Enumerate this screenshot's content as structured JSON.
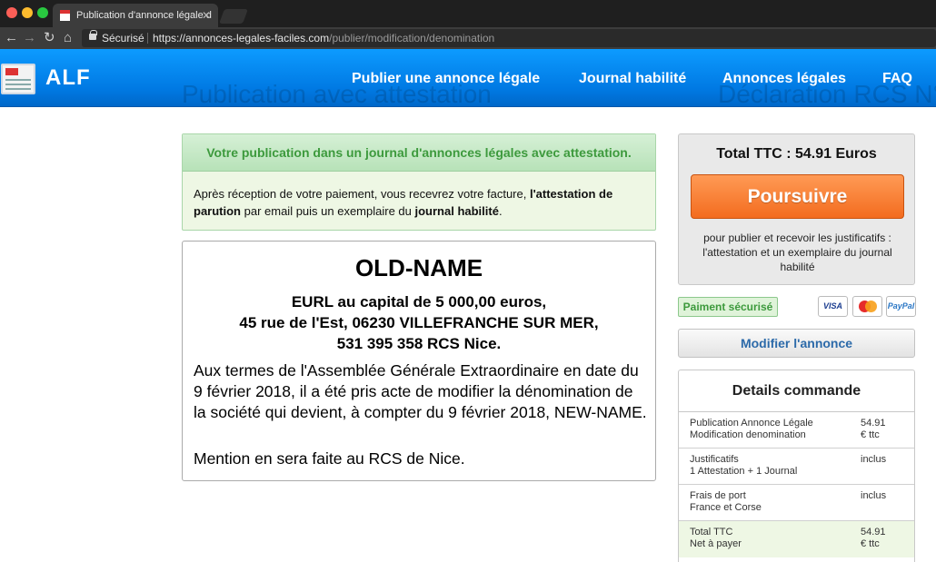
{
  "browser": {
    "tab_title": "Publication d'annonce légale d",
    "tab_close": "✕",
    "secure_label": "Sécurisé",
    "url_host": "https://annonces-legales-faciles.com",
    "url_path": "/publier/modification/denomination"
  },
  "header": {
    "logo": "ALF",
    "ghost_title": "Publication avec attestation",
    "ghost_right": "Déclaration RCS N°",
    "nav": [
      {
        "label": "Publier une annonce légale"
      },
      {
        "label": "Journal habilité"
      },
      {
        "label": "Annonces légales"
      },
      {
        "label": "FAQ"
      }
    ]
  },
  "notice": {
    "title": "Votre publication dans un journal d'annonces légales avec attestation.",
    "body_1": "Après réception de votre paiement, vous recevrez votre facture, ",
    "body_bold_1": "l'attestation de parution",
    "body_2": " par email puis un exemplaire du ",
    "body_bold_2": "journal habilité",
    "body_3": "."
  },
  "announcement": {
    "company": "OLD-NAME",
    "line1": "EURL au capital de 5 000,00 euros,",
    "line2": "45 rue de l'Est, 06230 VILLEFRANCHE SUR MER,",
    "line3": "531 395 358 RCS Nice.",
    "paragraph": "Aux termes de l'Assemblée Générale Extraordinaire en date du 9 février 2018, il a été pris acte de modifier la dénomination de la société qui devient, à compter du 9 février 2018, NEW-NAME.",
    "mention": "Mention en sera faite au RCS de Nice."
  },
  "sidebar": {
    "total": "Total TTC : 54.91 Euros",
    "pay_button": "Poursuivre",
    "pay_note": "pour publier et recevoir les justificatifs : l'attestation et un exemplaire du journal habilité",
    "secure_payment": "Paiment sécurisé",
    "cards": {
      "visa": "VISA",
      "paypal": "PayPal"
    },
    "modify_button": "Modifier l'annonce",
    "details_title": "Details commande",
    "details": [
      {
        "label_1": "Publication Annonce Légale",
        "label_2": "Modification denomination",
        "value_1": "54.91",
        "value_2": "€ ttc"
      },
      {
        "label_1": "Justificatifs",
        "label_2": "1 Attestation + 1 Journal",
        "value_1": "inclus",
        "value_2": ""
      },
      {
        "label_1": "Frais de port",
        "label_2": "France et Corse",
        "value_1": "inclus",
        "value_2": ""
      },
      {
        "label_1": "Total TTC",
        "label_2": "Net à payer",
        "value_1": "54.91",
        "value_2": "€ ttc"
      }
    ]
  }
}
